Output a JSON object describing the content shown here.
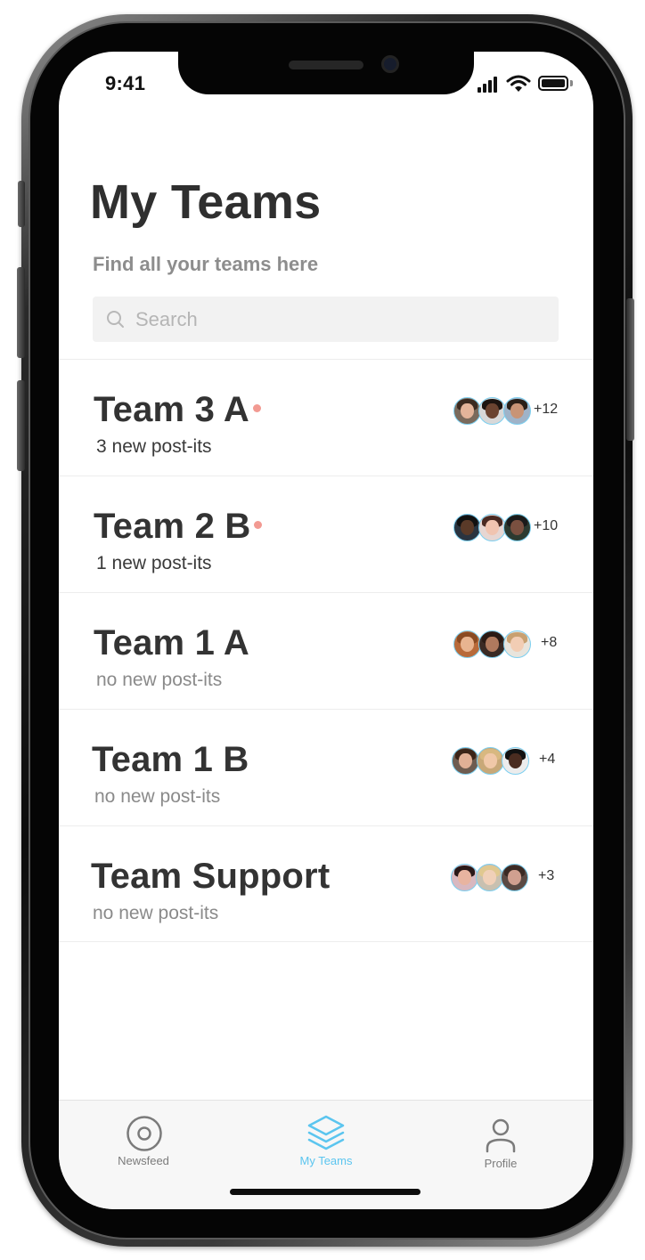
{
  "status_bar": {
    "time": "9:41"
  },
  "header": {
    "title": "My Teams",
    "subtitle": "Find all your teams here"
  },
  "search": {
    "placeholder": "Search"
  },
  "colors": {
    "accent": "#5bc5ef",
    "unread_dot": "#f29a92",
    "title_text": "#2f2f2f",
    "muted_text": "#8a8a8a"
  },
  "teams": [
    {
      "name": "Team 3 A",
      "status": "3 new post-its",
      "unread": true,
      "more_members": "+12"
    },
    {
      "name": "Team 2 B",
      "status": "1 new post-its",
      "unread": true,
      "more_members": "+10"
    },
    {
      "name": "Team 1 A",
      "status": "no new post-its",
      "unread": false,
      "more_members": "+8"
    },
    {
      "name": "Team 1 B",
      "status": "no new post-its",
      "unread": false,
      "more_members": "+4"
    },
    {
      "name": "Team Support",
      "status": "no new post-its",
      "unread": false,
      "more_members": "+3"
    }
  ],
  "tab_bar": {
    "tabs": [
      {
        "label": "Newsfeed",
        "icon": "target-icon",
        "active": false
      },
      {
        "label": "My Teams",
        "icon": "layers-icon",
        "active": true
      },
      {
        "label": "Profile",
        "icon": "person-icon",
        "active": false
      }
    ]
  }
}
